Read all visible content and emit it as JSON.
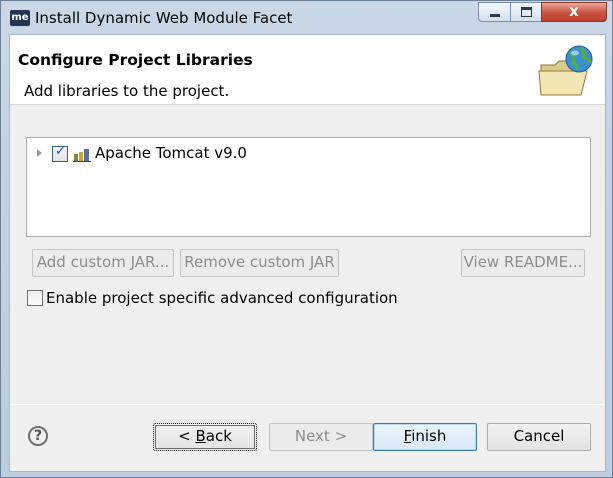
{
  "window": {
    "app_icon_text": "me",
    "title": "Install Dynamic Web Module Facet",
    "close_glyph": "x"
  },
  "header": {
    "title": "Configure Project Libraries",
    "subtitle": "Add libraries to the project.",
    "art_icon": "folder-globe-icon"
  },
  "libraries": [
    {
      "label": "Apache Tomcat v9.0",
      "checked": true,
      "icon": "server-library-icon"
    }
  ],
  "buttons": {
    "add_custom_jar": "Add custom JAR...",
    "remove_custom_jar": "Remove custom JAR",
    "view_readme": "View README..."
  },
  "advanced": {
    "label": "Enable project specific advanced configuration",
    "checked": false
  },
  "footer": {
    "help_glyph": "?",
    "back_label": "< Back",
    "back_mnemonic": "B",
    "next_label": "Next >",
    "finish_label": "Finish",
    "finish_mnemonic": "F",
    "cancel_label": "Cancel"
  },
  "colors": {
    "default_button_border": "#3c7fb1",
    "disabled_text": "#8d8d8d"
  }
}
